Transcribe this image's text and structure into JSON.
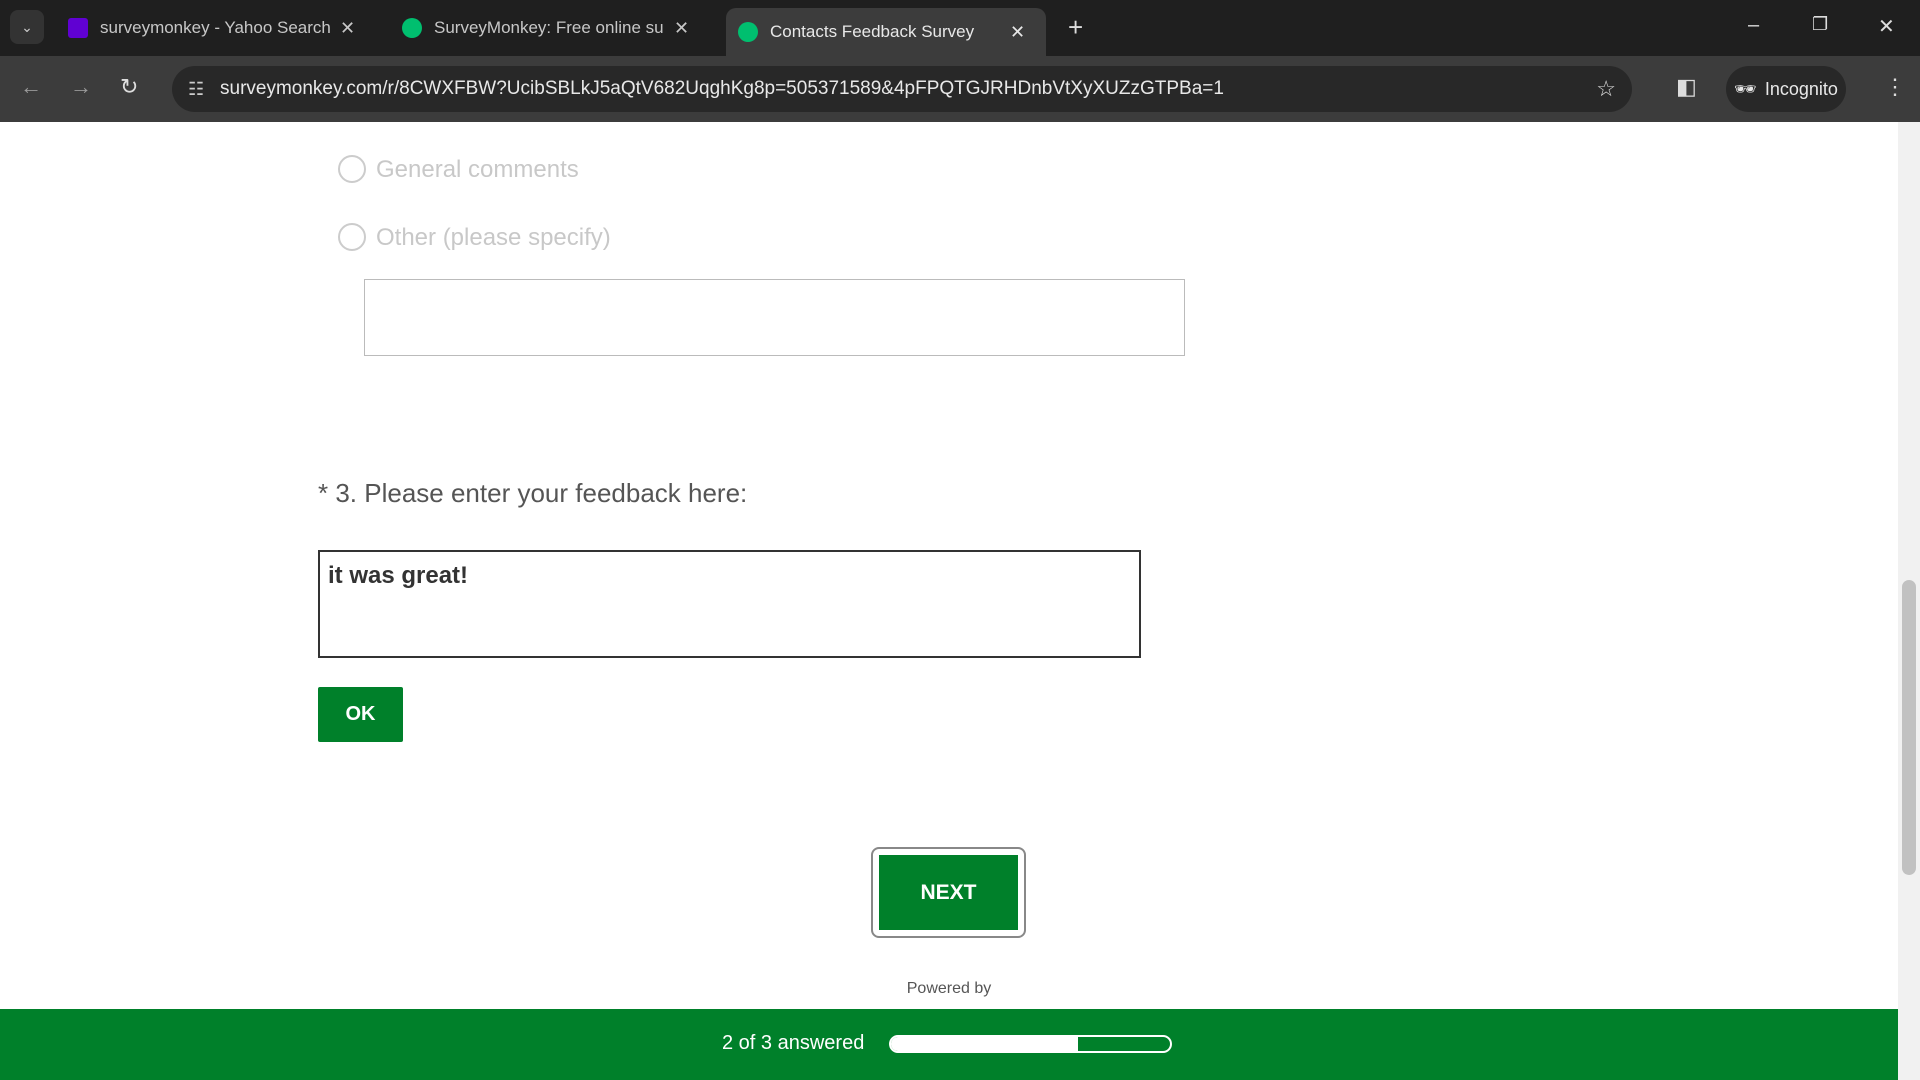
{
  "browser": {
    "tabs": [
      {
        "title": "surveymonkey - Yahoo Search R",
        "icon": "yahoo-icon",
        "active": false
      },
      {
        "title": "SurveyMonkey: Free online survey",
        "icon": "surveymonkey-icon",
        "active": false
      },
      {
        "title": "Contacts Feedback Survey",
        "icon": "surveymonkey-icon",
        "active": true
      }
    ],
    "url": "surveymonkey.com/r/8CWXFBW?UcibSBLkJ5aQtV682UqghKg8p=505371589&4pFPQTGJRHDnbVtXyXUZzGTPBa=1",
    "incognito_label": "Incognito"
  },
  "survey": {
    "options": [
      "General comments",
      "Other (please specify)"
    ],
    "other_value": "",
    "question": "* 3. Please enter your feedback here:",
    "feedback_value": "it was great!",
    "ok_label": "OK",
    "next_label": "NEXT",
    "powered_by": "Powered by",
    "progress_text": "2 of 3 answered",
    "progress_fraction": 0.67
  },
  "colors": {
    "accent": "#00802a"
  }
}
